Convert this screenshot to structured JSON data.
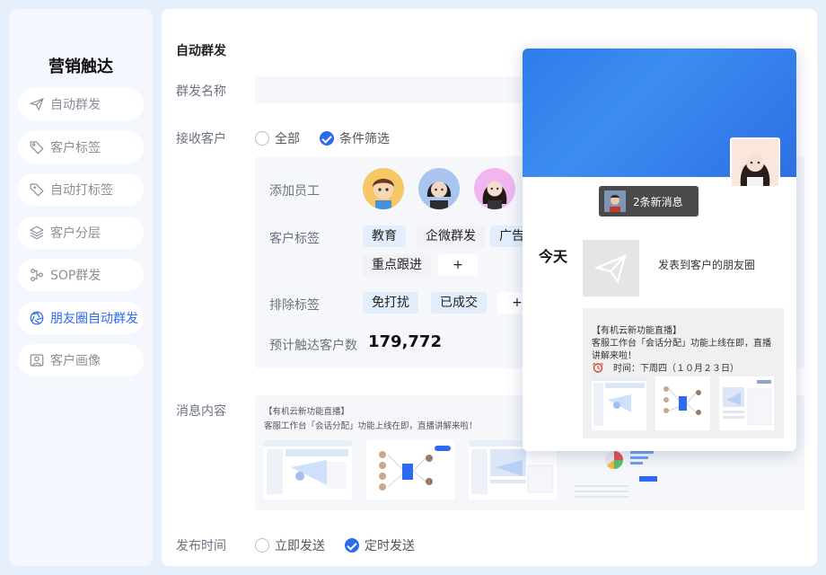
{
  "sidebar": {
    "title": "营销触达",
    "items": [
      {
        "label": "自动群发",
        "icon": "paper-plane-icon"
      },
      {
        "label": "客户标签",
        "icon": "tag-icon"
      },
      {
        "label": "自动打标签",
        "icon": "tag-plus-icon"
      },
      {
        "label": "客户分层",
        "icon": "layers-icon"
      },
      {
        "label": "SOP群发",
        "icon": "flow-icon"
      },
      {
        "label": "朋友圈自动群发",
        "icon": "aperture-icon",
        "active": true
      },
      {
        "label": "客户画像",
        "icon": "portrait-icon"
      }
    ]
  },
  "form": {
    "section_title": "自动群发",
    "name_label": "群发名称",
    "name_value": "",
    "receiver_label": "接收客户",
    "receiver_options": [
      {
        "label": "全部",
        "checked": false
      },
      {
        "label": "条件筛选",
        "checked": true
      }
    ],
    "filter": {
      "staff_label": "添加员工",
      "tag_label": "客户标签",
      "tags": [
        "教育",
        "企微群发",
        "广告投",
        "重点跟进"
      ],
      "add_label": "+",
      "exclude_label": "排除标签",
      "exclude_tags": [
        "免打扰",
        "已成交"
      ],
      "reach_label": "预计触达客户数",
      "reach_value": "179,772"
    },
    "message_label": "消息内容",
    "message_line1": "【有机云新功能直播】",
    "message_line2": "客服工作台「会话分配」功能上线在即，直播讲解来啦！",
    "publish_label": "发布时间",
    "publish_options": [
      {
        "label": "立即发送",
        "checked": false
      },
      {
        "label": "定时发送",
        "checked": true
      }
    ]
  },
  "preview": {
    "new_messages": "2条新消息",
    "today": "今天",
    "share_text": "发表到客户的朋友圈",
    "post_line1": "【有机云新功能直播】",
    "post_line2": "客服工作台「会话分配」功能上线在即，直播",
    "post_line3": "讲解来啦！",
    "post_time": "时间：下周四（１０月２３日）"
  },
  "colors": {
    "accent": "#2c6bf0",
    "banner": "#3584ee",
    "page_bg": "#e6f0fd"
  }
}
